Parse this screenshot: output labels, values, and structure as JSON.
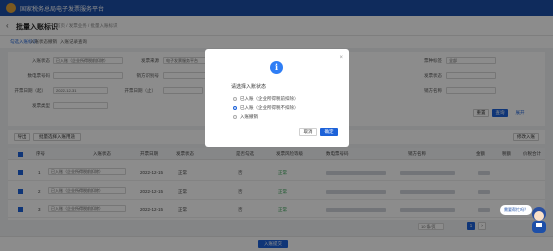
{
  "app": {
    "title": "国家税务总局电子发票服务平台"
  },
  "page": {
    "back": "‹",
    "title": "批量入账标识",
    "breadcrumb": "首页 / 发票业务 / 批量入账标识"
  },
  "subtabs": [
    "勾选入账标识",
    "入账状态撤销",
    "入账记录查询"
  ],
  "form": {
    "fields": [
      {
        "label": "入账状态",
        "value": "已入账（企业所得税前扣除）"
      },
      {
        "label": "发票来源",
        "value": "电子发票服务平台"
      },
      {
        "label": "票种标签",
        "value": "全部"
      },
      {
        "label": "数电票号码",
        "value": ""
      },
      {
        "label": "销方识别号",
        "value": ""
      },
      {
        "label": "发票状态",
        "value": ""
      },
      {
        "label": "开票日期（起）",
        "value": "2022-12-31"
      },
      {
        "label": "开票日期（止）",
        "value": ""
      },
      {
        "label": "销方名称",
        "value": ""
      },
      {
        "label": "发票类型",
        "value": ""
      }
    ],
    "reset_label": "重置",
    "query_label": "查询",
    "expand_label": "展开"
  },
  "toolbar": {
    "btn1": "导出",
    "btn2": "批量选择入账用途",
    "right": "修改入账"
  },
  "table": {
    "headers": [
      "序号",
      "入账状态",
      "开票日期",
      "发票状态",
      "是否勾选",
      "发票风险等级",
      "数电票号码",
      "销方名称",
      "金额",
      "税额",
      "价税合计"
    ],
    "rows": [
      {
        "idx": "1",
        "status": "已入账（企业所得税前扣除）",
        "date": "2022-12-15",
        "state": "正常",
        "tick": "否",
        "risk": "正常",
        "amount": "",
        "tax": ""
      },
      {
        "idx": "2",
        "status": "已入账（企业所得税前扣除）",
        "date": "2022-12-15",
        "state": "正常",
        "tick": "否",
        "risk": "正常",
        "amount": "",
        "tax": ""
      },
      {
        "idx": "3",
        "status": "已入账（企业所得税前扣除）",
        "date": "2022-12-15",
        "state": "正常",
        "tick": "否",
        "risk": "正常",
        "amount": "",
        "tax": ""
      }
    ]
  },
  "pager": {
    "size": "10 条/页",
    "page": "1",
    "next": "›"
  },
  "bottom": {
    "confirm_label": "入账提交"
  },
  "modal": {
    "title": "请选择入账状态",
    "close": "×",
    "icon_glyph": "i",
    "options": [
      "已入账（企业所得税前扣除）",
      "已入账（企业所得税不扣除）",
      "入账撤销"
    ],
    "selected_index": 1,
    "cancel_label": "取消",
    "ok_label": "确定"
  },
  "assistant": {
    "bubble": "需要帮忙吗？"
  },
  "colors": {
    "brand": "#1d4fa8",
    "primary": "#1d62d9",
    "info": "#2f7ef5",
    "ok": "#2e9e4f"
  }
}
